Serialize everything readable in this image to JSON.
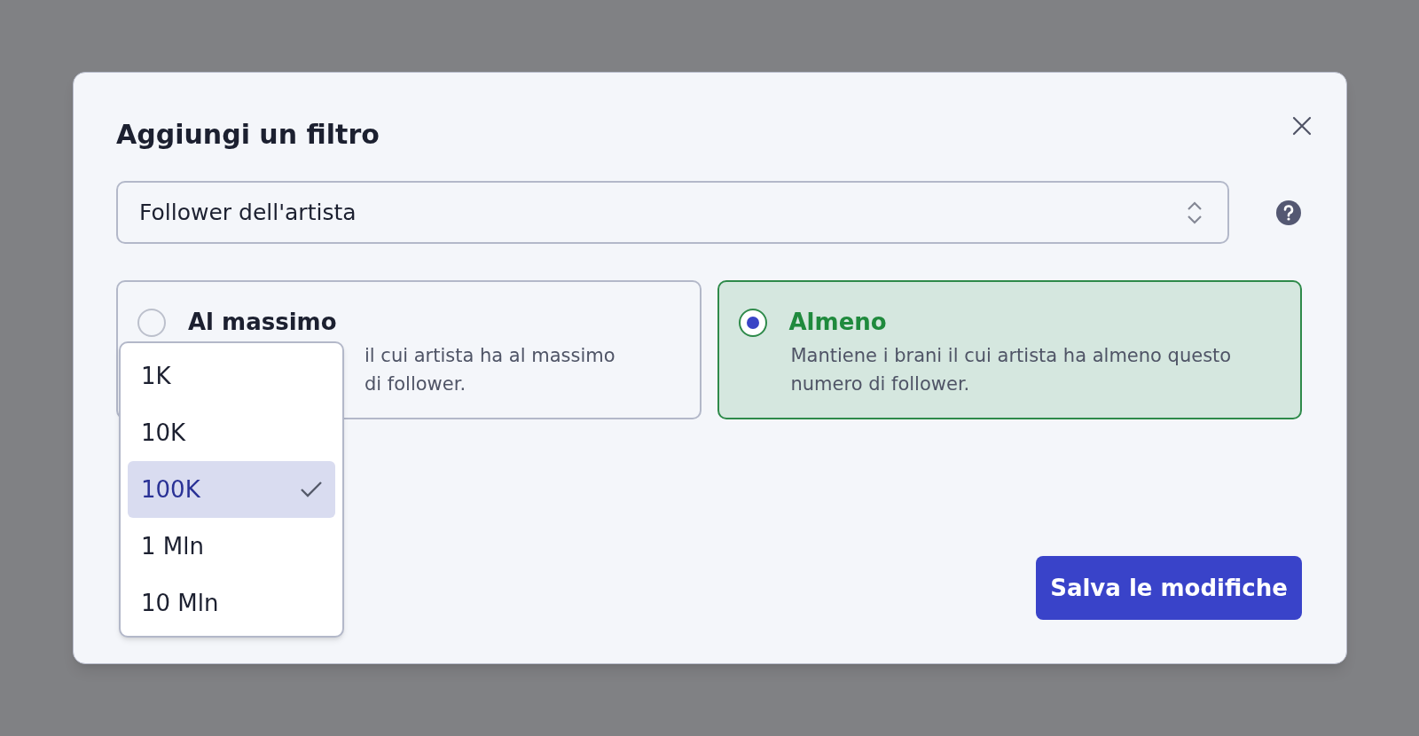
{
  "dialog": {
    "title": "Aggiungi un filtro"
  },
  "filter_select": {
    "value": "Follower dell'artista"
  },
  "options": [
    {
      "title": "Al massimo",
      "description_lines": [
        "il cui artista ha al massimo",
        "di follower."
      ],
      "selected": false
    },
    {
      "title": "Almeno",
      "description_lines": [
        "Mantiene i brani il cui artista ha almeno questo",
        "numero di follower."
      ],
      "selected": true
    }
  ],
  "dropdown": {
    "open": true,
    "items": [
      {
        "label": "1K",
        "selected": false
      },
      {
        "label": "10K",
        "selected": false
      },
      {
        "label": "100K",
        "selected": true
      },
      {
        "label": "1 Mln",
        "selected": false
      },
      {
        "label": "10 Mln",
        "selected": false
      }
    ]
  },
  "save_button": {
    "label": "Salva le modifiche"
  }
}
